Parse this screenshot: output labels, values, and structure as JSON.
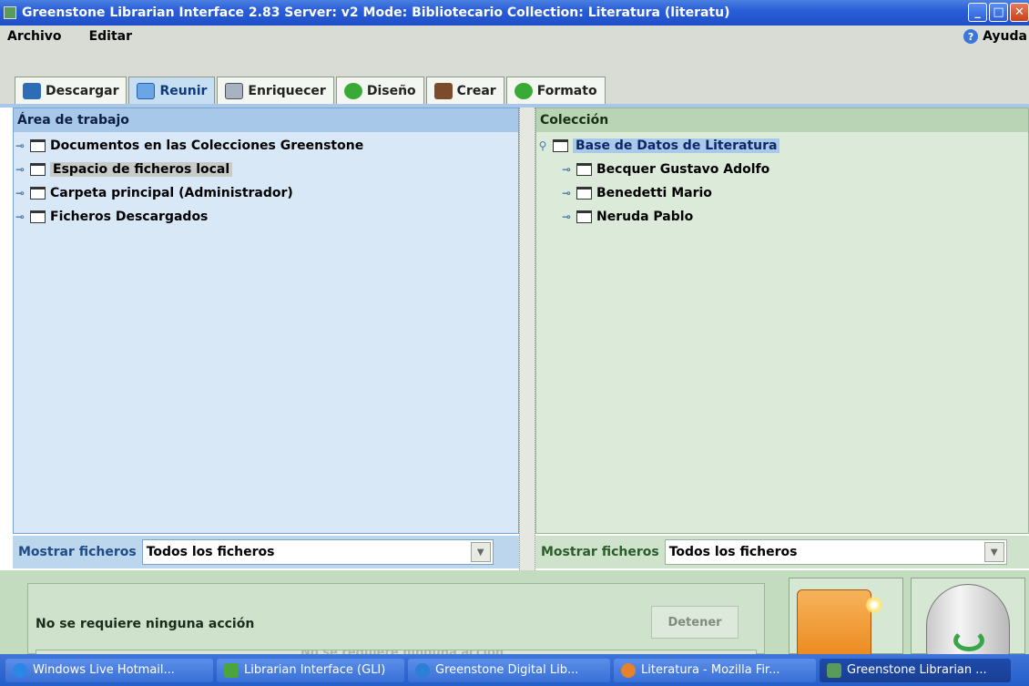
{
  "window": {
    "title": "Greenstone Librarian Interface 2.83  Server: v2  Mode: Bibliotecario  Collection: Literatura (literatu)",
    "controls": [
      "minimize-icon",
      "maximize-icon",
      "close-icon"
    ]
  },
  "menubar": {
    "items": [
      "Archivo",
      "Editar"
    ],
    "help_label": "Ayuda"
  },
  "tabs": [
    {
      "label": "Descargar",
      "icon": "download-icon",
      "active": false
    },
    {
      "label": "Reunir",
      "icon": "gather-icon",
      "active": true
    },
    {
      "label": "Enriquecer",
      "icon": "enrich-icon",
      "active": false
    },
    {
      "label": "Diseño",
      "icon": "gear-icon",
      "active": false
    },
    {
      "label": "Crear",
      "icon": "create-icon",
      "active": false
    },
    {
      "label": "Formato",
      "icon": "gear-icon",
      "active": false
    }
  ],
  "workspace": {
    "header": "Área de trabajo",
    "items": [
      "Documentos en las Colecciones Greenstone",
      "Espacio de ficheros local",
      "Carpeta principal (Administrador)",
      "Ficheros Descargados"
    ],
    "selected": "Espacio de ficheros local",
    "filter_label": "Mostrar ficheros",
    "filter_value": "Todos los ficheros"
  },
  "collection": {
    "header": "Colección",
    "root": "Base de Datos de Literatura",
    "children": [
      "Becquer Gustavo Adolfo",
      "Benedetti Mario",
      "Neruda Pablo"
    ],
    "filter_label": "Mostrar ficheros",
    "filter_value": "Todos los ficheros"
  },
  "status": {
    "message": "No se requiere ninguna acción",
    "stop_label": "Detener",
    "progress_text": "No se requiere ninguna acción"
  },
  "actions": [
    "new-folder-icon",
    "recycle-bin-icon"
  ],
  "taskbar": [
    {
      "label": "Windows Live Hotmail...",
      "icon": "internet-explorer-icon",
      "active": false
    },
    {
      "label": "Librarian Interface (GLI)",
      "icon": "gli-icon",
      "active": false
    },
    {
      "label": "Greenstone Digital Lib...",
      "icon": "browser-icon",
      "active": false
    },
    {
      "label": "Literatura - Mozilla Fir...",
      "icon": "firefox-icon",
      "active": false
    },
    {
      "label": "Greenstone Librarian ...",
      "icon": "greenstone-icon",
      "active": true
    }
  ],
  "colors": {
    "titlebar": "#245ec9",
    "workspace_bg": "#d8e8f6",
    "collection_bg": "#dcebd9",
    "status_bg": "#c3dcc0"
  }
}
